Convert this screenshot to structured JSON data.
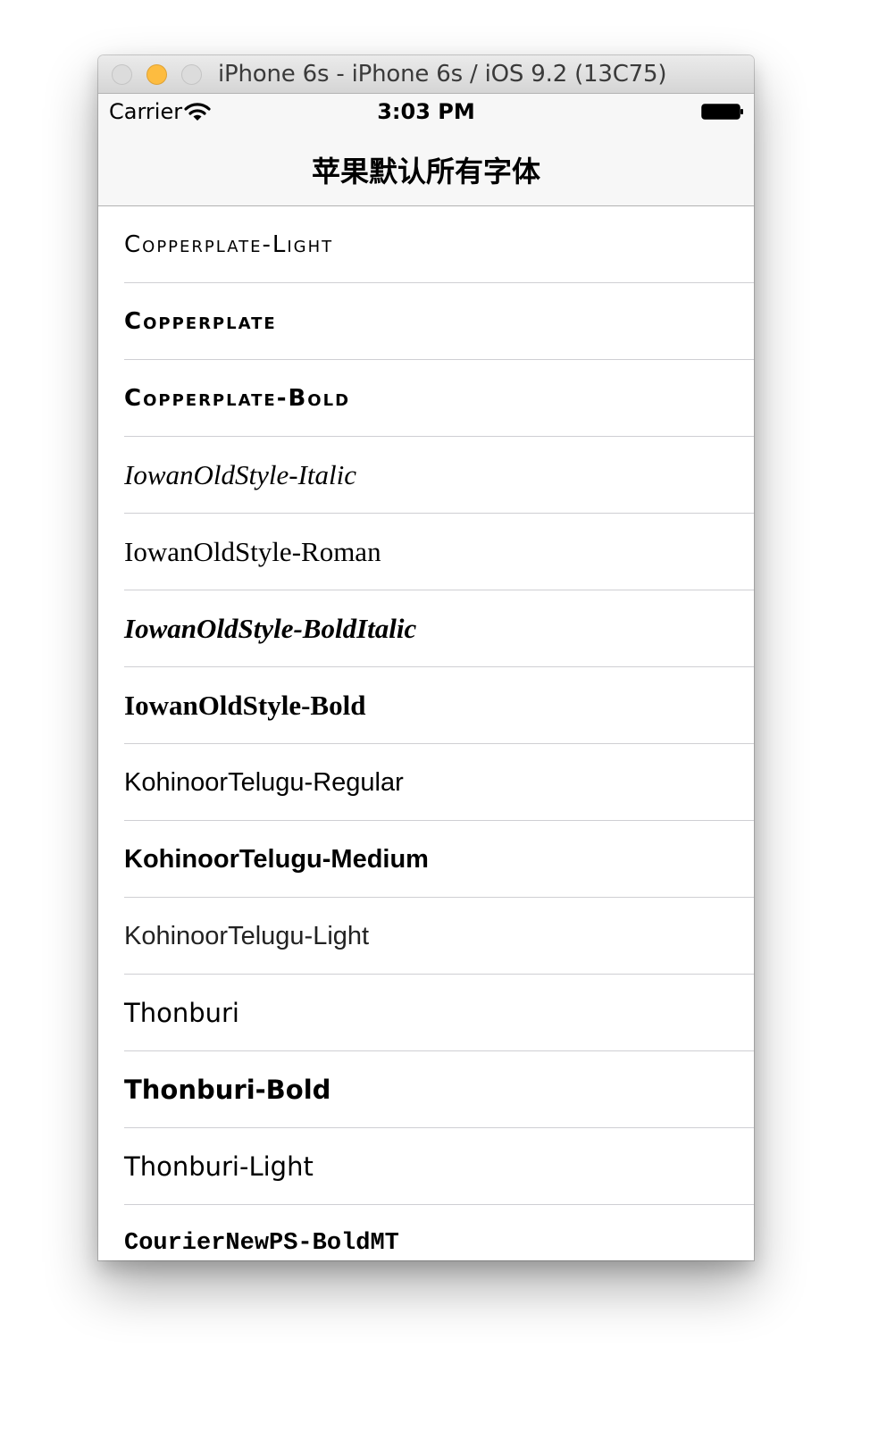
{
  "window": {
    "title": "iPhone 6s - iPhone 6s / iOS 9.2 (13C75)"
  },
  "status_bar": {
    "carrier": "Carrier",
    "time": "3:03 PM",
    "wifi_icon": "wifi-icon",
    "battery_icon": "battery-icon"
  },
  "nav": {
    "title": "苹果默认所有字体"
  },
  "fonts": [
    "Copperplate-Light",
    "Copperplate",
    "Copperplate-Bold",
    "IowanOldStyle-Italic",
    "IowanOldStyle-Roman",
    "IowanOldStyle-BoldItalic",
    "IowanOldStyle-Bold",
    "KohinoorTelugu-Regular",
    "KohinoorTelugu-Medium",
    "KohinoorTelugu-Light",
    "Thonburi",
    "Thonburi-Bold",
    "Thonburi-Light",
    "CourierNewPS-BoldMT"
  ],
  "colors": {
    "minimize_button": "#fdbc40",
    "navbar_background": "#f7f7f7",
    "separator": "#cfcfd3"
  }
}
